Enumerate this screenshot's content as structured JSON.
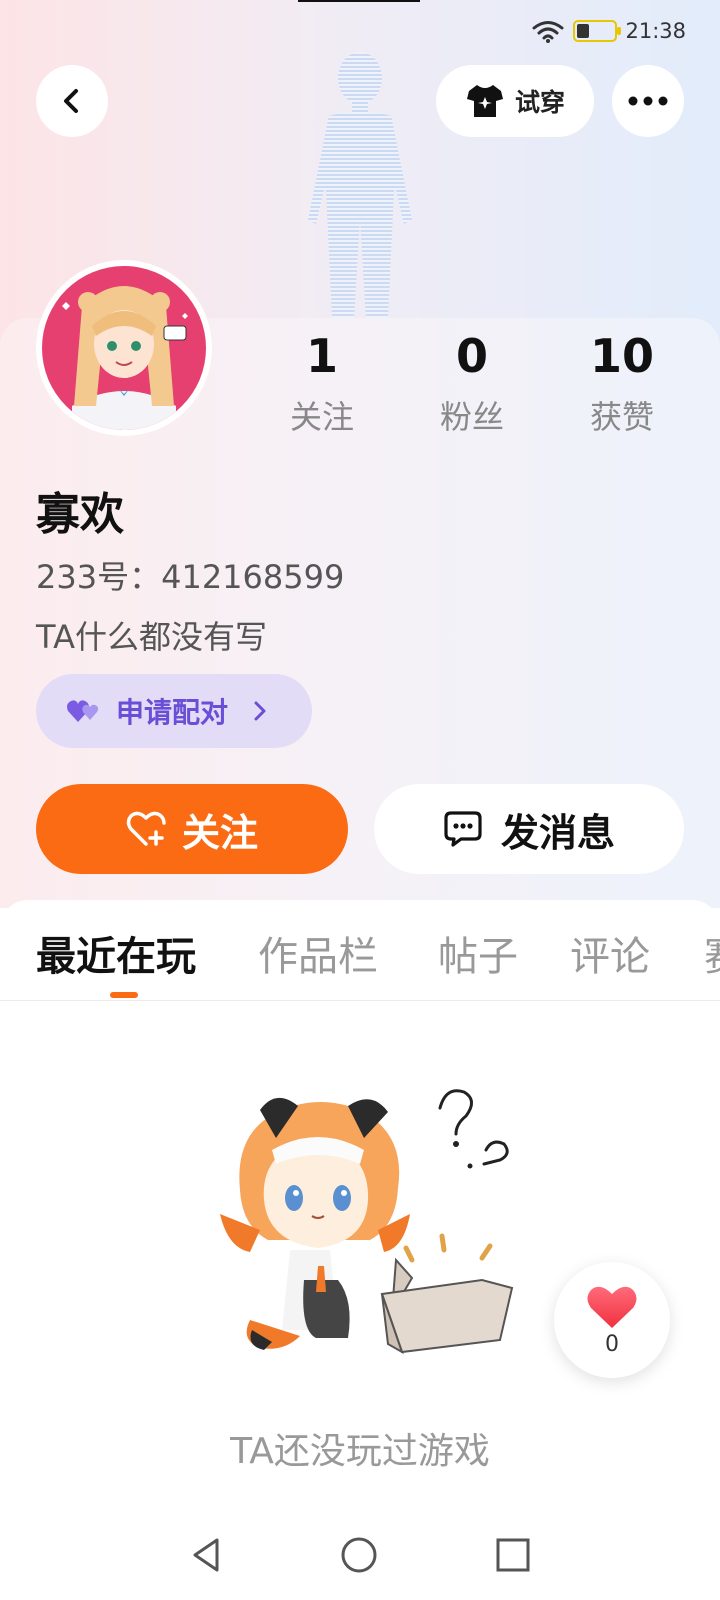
{
  "status_bar": {
    "time": "21:38"
  },
  "header": {
    "tryon_label": "试穿"
  },
  "profile": {
    "name": "寡欢",
    "uid_label": "233号：",
    "uid": "412168599",
    "bio": "TA什么都没有写",
    "pair_label": "申请配对",
    "stats": [
      {
        "value": "1",
        "label": "关注"
      },
      {
        "value": "0",
        "label": "粉丝"
      },
      {
        "value": "10",
        "label": "获赞"
      }
    ]
  },
  "actions": {
    "follow_label": "关注",
    "message_label": "发消息"
  },
  "tabs": [
    {
      "label": "最近在玩",
      "active": true
    },
    {
      "label": "作品栏",
      "active": false
    },
    {
      "label": "帖子",
      "active": false
    },
    {
      "label": "评论",
      "active": false
    },
    {
      "label": "赛",
      "active": false
    }
  ],
  "empty_state": {
    "text": "TA还没玩过游戏"
  },
  "like_float": {
    "count": "0"
  },
  "colors": {
    "accent": "#fb6b14",
    "pair_bg": "#e3dcf6",
    "pair_text": "#6a4fd6",
    "like_red": "#f4435a"
  },
  "icons": {
    "back": "back-arrow-icon",
    "tryon": "tshirt-icon",
    "more": "more-dots-icon",
    "pair": "double-heart-icon",
    "follow": "heart-plus-icon",
    "message": "chat-bubble-icon",
    "like": "heart-icon"
  }
}
